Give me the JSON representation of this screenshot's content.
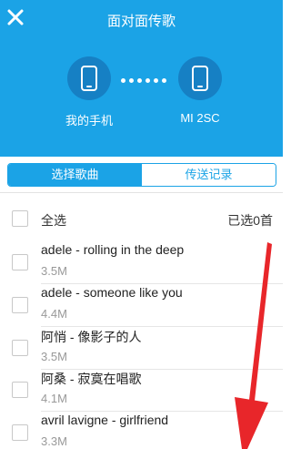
{
  "header": {
    "title": "面对面传歌",
    "close_icon": "close-icon",
    "background": "#1ba3e6",
    "device_bg": "#1680c4"
  },
  "devices": {
    "left": {
      "label": "我的手机",
      "icon": "phone-icon"
    },
    "right": {
      "label": "MI 2SC",
      "icon": "phone-icon"
    }
  },
  "tabs": [
    {
      "label": "选择歌曲",
      "active": true
    },
    {
      "label": "传送记录",
      "active": false
    }
  ],
  "select_all": {
    "label": "全选",
    "count_text": "已选0首"
  },
  "songs": [
    {
      "name": "adele - rolling in the deep",
      "size": "3.5M"
    },
    {
      "name": "adele - someone like you",
      "size": "4.4M"
    },
    {
      "name": "阿悄 - 像影子的人",
      "size": "3.5M"
    },
    {
      "name": "阿桑 - 寂寞在唱歌",
      "size": "4.1M"
    },
    {
      "name": "avril lavigne - girlfriend",
      "size": "3.3M"
    }
  ],
  "annotation": {
    "color": "#e8262a",
    "icon": "red-arrow-annotation"
  }
}
